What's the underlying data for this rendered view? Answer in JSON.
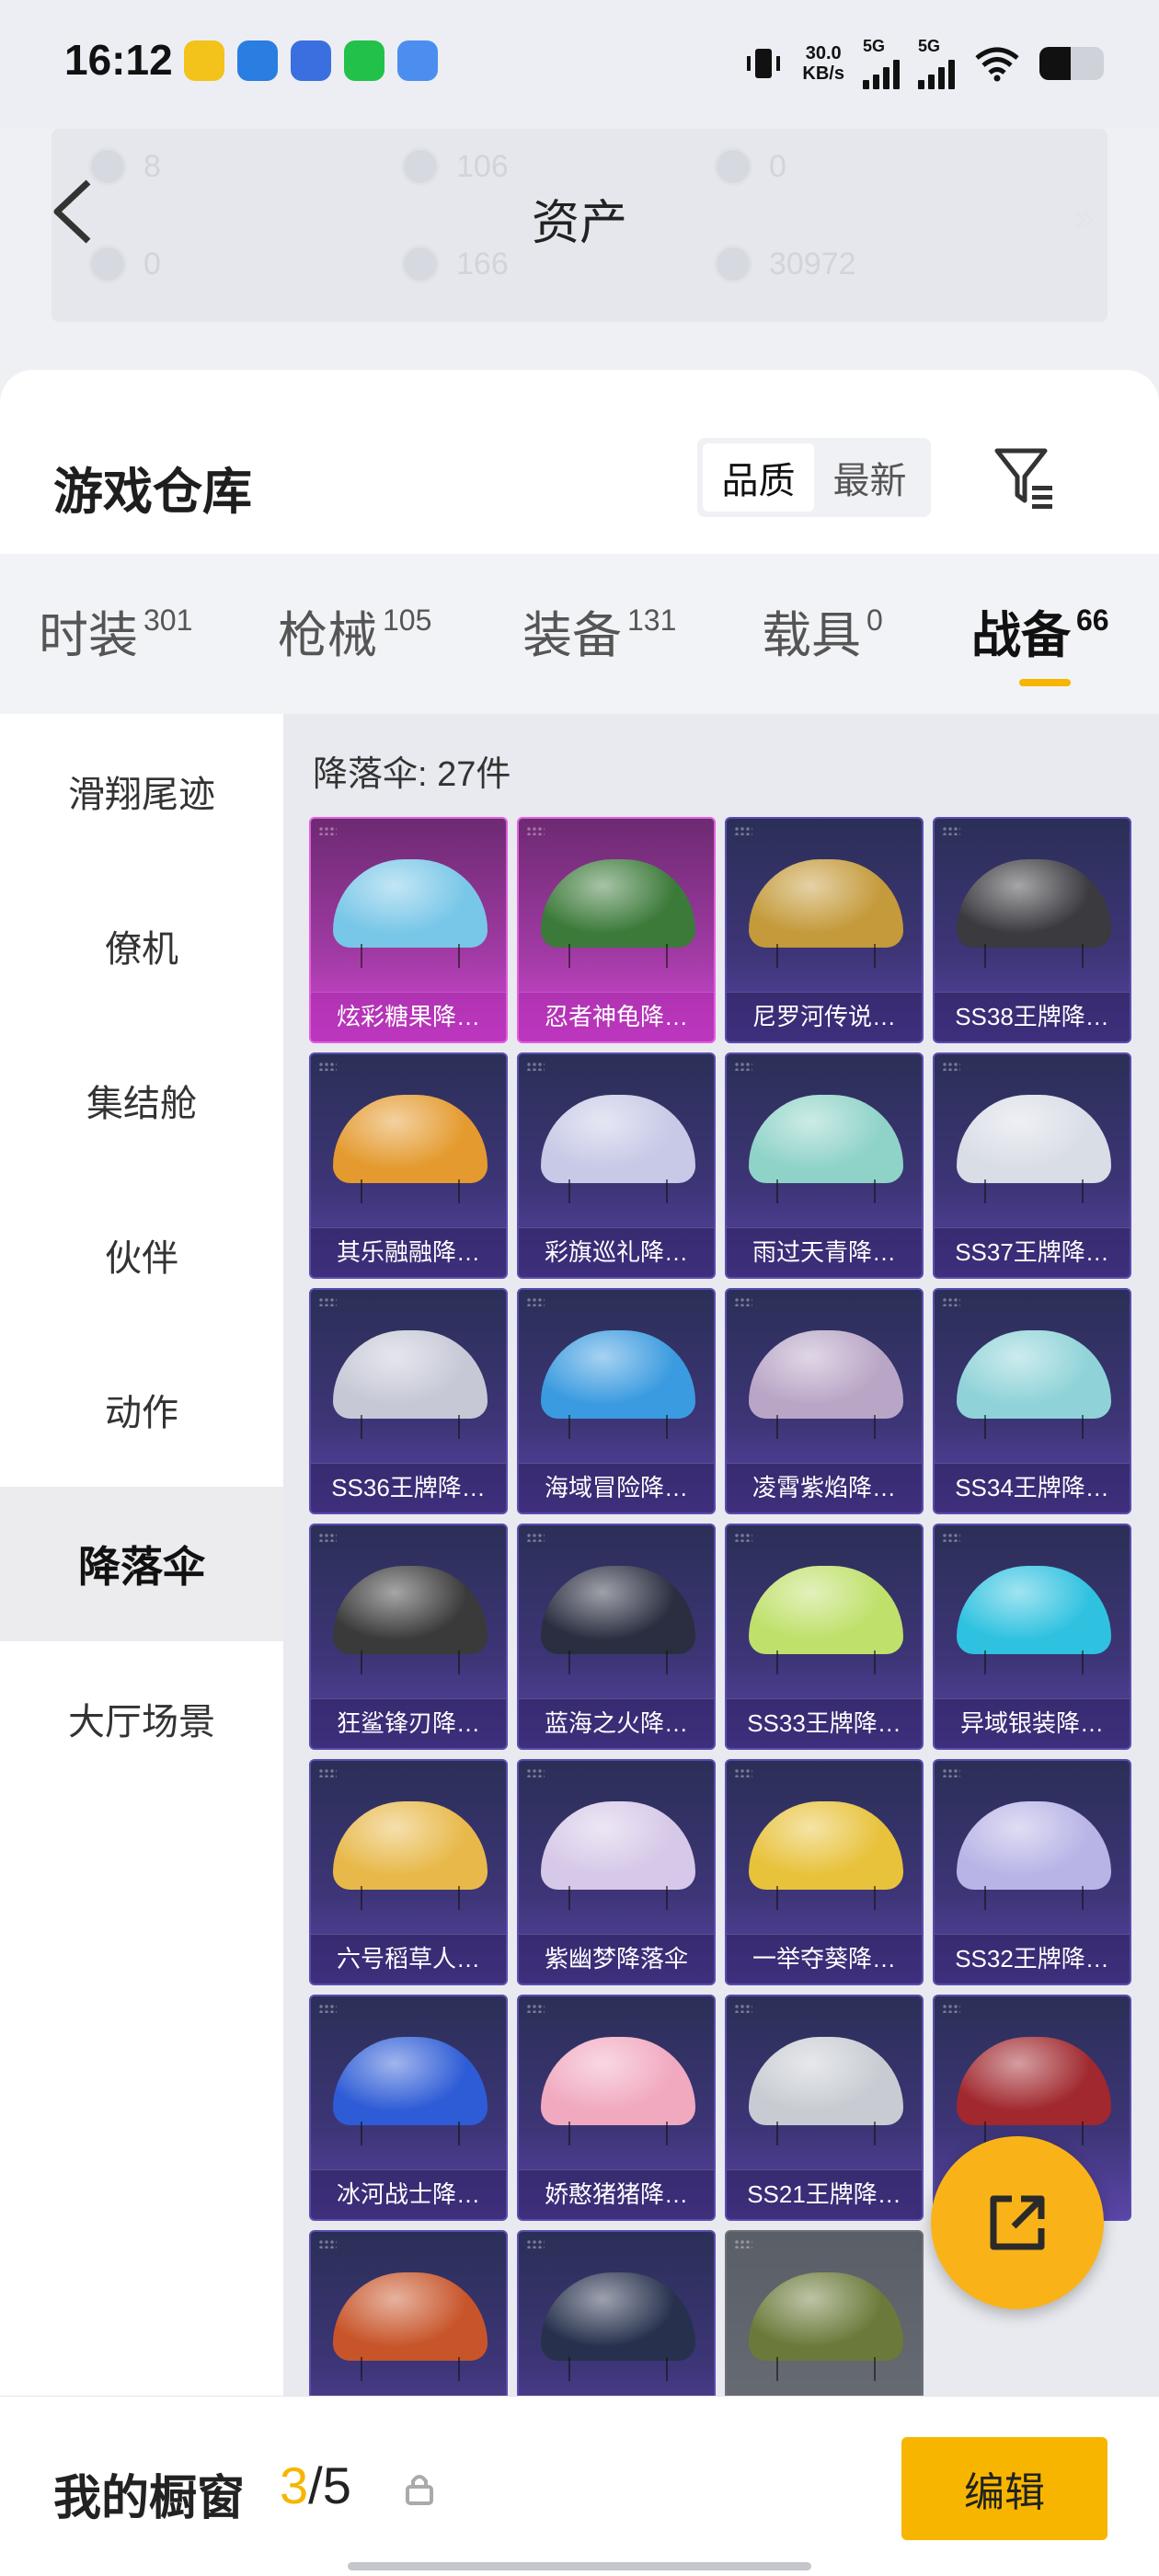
{
  "status_bar": {
    "time": "16:12",
    "net_speed_value": "30.0",
    "net_speed_unit": "KB/s",
    "sig1": "5G",
    "sig2": "5G"
  },
  "header": {
    "title": "资产",
    "stats": [
      "8",
      "106",
      "0",
      "0",
      "166",
      "30972"
    ]
  },
  "warehouse": {
    "title": "游戏仓库",
    "sort_options": [
      "品质",
      "最新"
    ],
    "selected_sort": "品质"
  },
  "tabs": [
    {
      "label": "时装",
      "count": "301"
    },
    {
      "label": "枪械",
      "count": "105"
    },
    {
      "label": "装备",
      "count": "131"
    },
    {
      "label": "载具",
      "count": "0"
    },
    {
      "label": "战备",
      "count": "66"
    }
  ],
  "active_tab": "战备",
  "sidebar": [
    "滑翔尾迹",
    "僚机",
    "集结舱",
    "伙伴",
    "动作",
    "降落伞",
    "大厅场景"
  ],
  "active_sidebar": "降落伞",
  "grid": {
    "label": "降落伞: 27件",
    "items": [
      {
        "name": "炫彩糖果降…",
        "style": "pink",
        "color": "#79c7e8"
      },
      {
        "name": "忍者神龟降…",
        "style": "pink",
        "color": "#3c7a3a"
      },
      {
        "name": "尼罗河传说…",
        "style": "purple",
        "color": "#c49a3a"
      },
      {
        "name": "SS38王牌降…",
        "style": "purple",
        "color": "#3a3a3f"
      },
      {
        "name": "其乐融融降…",
        "style": "purple",
        "color": "#e49a2e"
      },
      {
        "name": "彩旗巡礼降…",
        "style": "purple",
        "color": "#c7c9e6"
      },
      {
        "name": "雨过天青降…",
        "style": "purple",
        "color": "#8fd3c8"
      },
      {
        "name": "SS37王牌降…",
        "style": "purple",
        "color": "#d9dde6"
      },
      {
        "name": "SS36王牌降…",
        "style": "purple",
        "color": "#c6c8d6"
      },
      {
        "name": "海域冒险降…",
        "style": "purple",
        "color": "#3b9be0"
      },
      {
        "name": "凌霄紫焰降…",
        "style": "purple",
        "color": "#b9a6c6"
      },
      {
        "name": "SS34王牌降…",
        "style": "purple",
        "color": "#8fd3d8"
      },
      {
        "name": "狂鲨锋刃降…",
        "style": "purple",
        "color": "#3a3a3a"
      },
      {
        "name": "蓝海之火降…",
        "style": "purple",
        "color": "#2a2e40"
      },
      {
        "name": "SS33王牌降…",
        "style": "purple",
        "color": "#bfe06a"
      },
      {
        "name": "异域银装降…",
        "style": "purple",
        "color": "#2fc2e0"
      },
      {
        "name": "六号稻草人…",
        "style": "purple",
        "color": "#e8b94a"
      },
      {
        "name": "紫幽梦降落伞",
        "style": "purple",
        "color": "#d6c8e8"
      },
      {
        "name": "一举夺葵降…",
        "style": "purple",
        "color": "#e8c23a"
      },
      {
        "name": "SS32王牌降…",
        "style": "purple",
        "color": "#b8b4e6"
      },
      {
        "name": "冰河战士降…",
        "style": "purple",
        "color": "#2e5cd6"
      },
      {
        "name": "娇憨猪猪降…",
        "style": "purple",
        "color": "#f1a9c0"
      },
      {
        "name": "SS21王牌降…",
        "style": "purple",
        "color": "#c8ccd2"
      },
      {
        "name": "",
        "style": "purple",
        "color": "#a0282e"
      },
      {
        "name": "",
        "style": "purple",
        "color": "#c8552a"
      },
      {
        "name": "",
        "style": "purple",
        "color": "#27314d"
      },
      {
        "name": "",
        "style": "gray",
        "color": "#6b7a3a"
      }
    ]
  },
  "bottom": {
    "title": "我的橱窗",
    "current": "3",
    "total": "/5",
    "edit_label": "编辑"
  },
  "colors": {
    "accent": "#f7b500",
    "fab": "#f9b319",
    "pink_card": "#d449d8",
    "purple_card": "#5b45a8"
  }
}
